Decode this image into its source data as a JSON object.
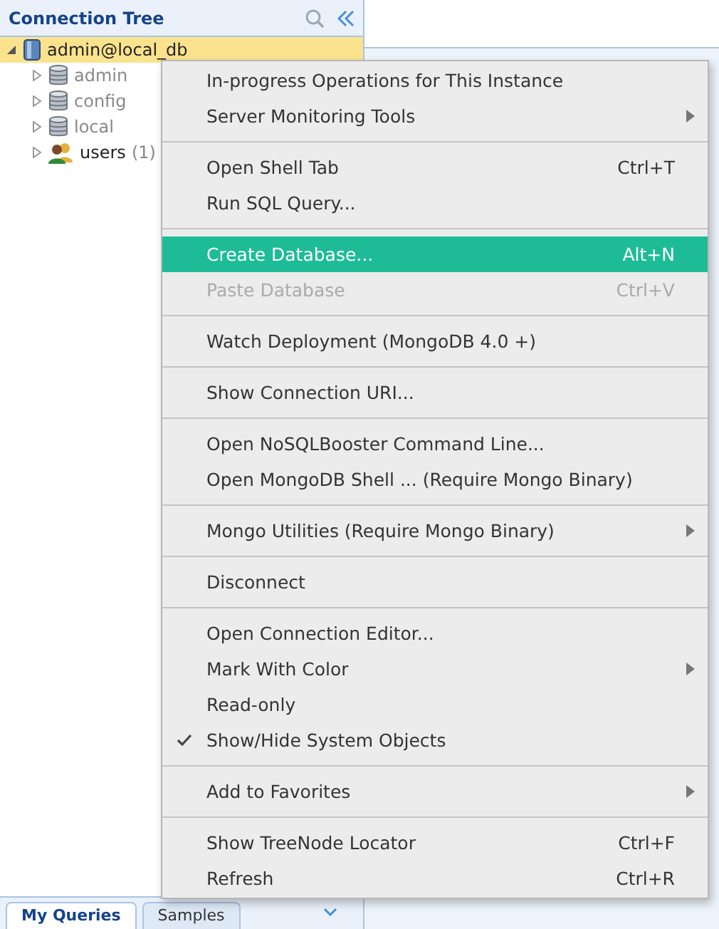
{
  "panel": {
    "title": "Connection Tree"
  },
  "tree": [
    {
      "label": "admin@local_db",
      "kind": "server",
      "selected": true,
      "expanded": true,
      "children": [
        {
          "label": "admin",
          "kind": "database",
          "system": true,
          "selected": false,
          "expanded": false
        },
        {
          "label": "config",
          "kind": "database",
          "system": true,
          "selected": false,
          "expanded": false
        },
        {
          "label": "local",
          "kind": "database",
          "system": true,
          "selected": false,
          "expanded": false
        },
        {
          "label": "users",
          "count": "(1)",
          "kind": "users",
          "system": false,
          "selected": false,
          "expanded": false
        }
      ]
    }
  ],
  "bottom_tabs": [
    {
      "label": "My Queries",
      "selected": true
    },
    {
      "label": "Samples",
      "selected": false
    }
  ],
  "context_menu": [
    [
      {
        "label": "In-progress Operations for This Instance",
        "selected": false,
        "disabled": false,
        "submenu": false,
        "checked": false
      },
      {
        "label": "Server Monitoring Tools",
        "selected": false,
        "disabled": false,
        "submenu": true,
        "checked": false
      }
    ],
    [
      {
        "label": "Open Shell Tab",
        "shortcut": "Ctrl+T",
        "selected": false,
        "disabled": false,
        "submenu": false,
        "checked": false
      },
      {
        "label": "Run SQL Query...",
        "selected": false,
        "disabled": false,
        "submenu": false,
        "checked": false
      }
    ],
    [
      {
        "label": "Create Database...",
        "shortcut": "Alt+N",
        "selected": true,
        "disabled": false,
        "submenu": false,
        "checked": false
      },
      {
        "label": "Paste Database",
        "shortcut": "Ctrl+V",
        "selected": false,
        "disabled": true,
        "submenu": false,
        "checked": false
      }
    ],
    [
      {
        "label": "Watch Deployment (MongoDB 4.0 +)",
        "selected": false,
        "disabled": false,
        "submenu": false,
        "checked": false
      }
    ],
    [
      {
        "label": "Show Connection URI...",
        "selected": false,
        "disabled": false,
        "submenu": false,
        "checked": false
      }
    ],
    [
      {
        "label": "Open NoSQLBooster Command Line...",
        "selected": false,
        "disabled": false,
        "submenu": false,
        "checked": false
      },
      {
        "label": "Open MongoDB Shell ... (Require Mongo Binary)",
        "selected": false,
        "disabled": false,
        "submenu": false,
        "checked": false
      }
    ],
    [
      {
        "label": "Mongo Utilities (Require Mongo Binary)",
        "selected": false,
        "disabled": false,
        "submenu": true,
        "checked": false
      }
    ],
    [
      {
        "label": "Disconnect",
        "selected": false,
        "disabled": false,
        "submenu": false,
        "checked": false
      }
    ],
    [
      {
        "label": "Open Connection Editor...",
        "selected": false,
        "disabled": false,
        "submenu": false,
        "checked": false
      },
      {
        "label": "Mark With Color",
        "selected": false,
        "disabled": false,
        "submenu": true,
        "checked": false
      },
      {
        "label": "Read-only",
        "selected": false,
        "disabled": false,
        "submenu": false,
        "checked": false
      },
      {
        "label": "Show/Hide System Objects",
        "selected": false,
        "disabled": false,
        "submenu": false,
        "checked": true
      }
    ],
    [
      {
        "label": "Add to Favorites",
        "selected": false,
        "disabled": false,
        "submenu": true,
        "checked": false
      }
    ],
    [
      {
        "label": "Show TreeNode Locator",
        "shortcut": "Ctrl+F",
        "selected": false,
        "disabled": false,
        "submenu": false,
        "checked": false
      },
      {
        "label": "Refresh",
        "shortcut": "Ctrl+R",
        "selected": false,
        "disabled": false,
        "submenu": false,
        "checked": false
      }
    ]
  ]
}
